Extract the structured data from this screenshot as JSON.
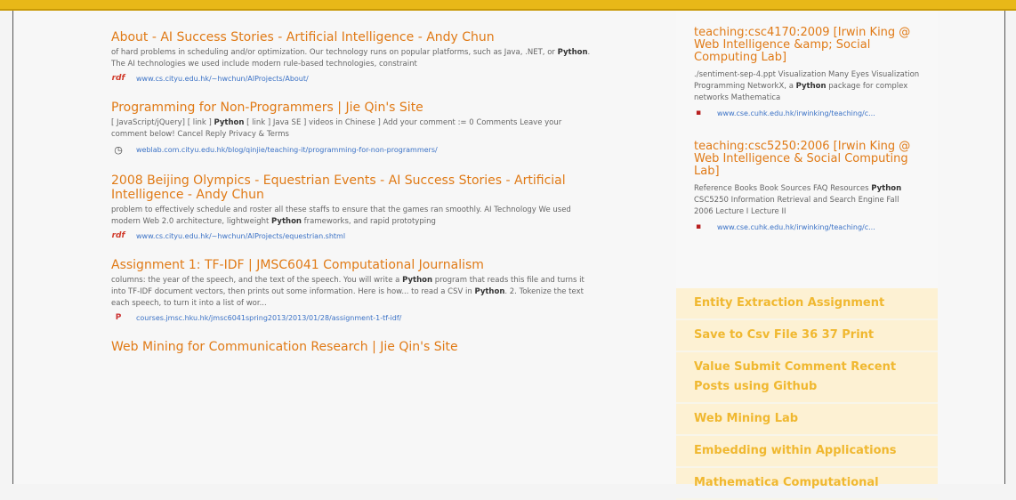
{
  "results": [
    {
      "title": "About - AI Success Stories - Artificial Intelligence - Andy Chun",
      "snippet_html": "of hard problems in scheduling and/or optimization. Our technology runs on popular platforms, such as Java, .NET, or <b>Python</b>. The AI technologies we used include modern rule-based technologies, constraint",
      "icon": "pdf-icon",
      "icon_glyph": "rdf",
      "url": "www.cs.cityu.edu.hk/~hwchun/AIProjects/About/"
    },
    {
      "title": "Programming for Non-Programmers | Jie Qin's Site",
      "snippet_html": "[ JavaScript/jQuery] [ link ] <b>Python</b> [ link ] Java SE ] videos in Chinese ] Add your comment := 0 Comments Leave your comment below! Cancel Reply Privacy &amp; Terms <iframe src=\"http://www.google.com/recaptcha/api",
      "icon": "clock-icon",
      "icon_glyph": "◷",
      "url": "weblab.com.cityu.edu.hk/blog/qinjie/teaching-it/programming-for-non-programmers/"
    },
    {
      "title": "2008 Beijing Olympics - Equestrian Events - AI Success Stories - Artificial Intelligence - Andy Chun",
      "snippet_html": "problem to effectively schedule and roster all these staffs to ensure that the games ran smoothly. AI Technology We used modern Web 2.0 architecture, lightweight <b>Python</b> frameworks, and rapid prototyping",
      "icon": "pdf-icon",
      "icon_glyph": "rdf",
      "url": "www.cs.cityu.edu.hk/~hwchun/AIProjects/equestrian.shtml"
    },
    {
      "title": "Assignment 1: TF-IDF | JMSC6041 Computational Journalism",
      "snippet_html": "columns: the year of the speech, and the text of the speech. You will write a <b>Python</b> program that reads this file and turns it into TF-IDF document vectors, then prints out some information. Here is how... to read a CSV in <b>Python</b>. 2. Tokenize the text each speech, to turn it into a list of wor...",
      "icon": "ppt-icon",
      "icon_glyph": "P",
      "url": "courses.jmsc.hku.hk/jmsc6041spring2013/2013/01/28/assignment-1-tf-idf/"
    },
    {
      "title": "Web Mining for Communication Research | Jie Qin's Site",
      "snippet_html": "",
      "icon": "",
      "icon_glyph": "",
      "url": ""
    }
  ],
  "sidebar": {
    "results": [
      {
        "title": "teaching:csc4170:2009 [Irwin King @ Web Intelligence &amp;amp; Social Computing Lab]",
        "snippet_html": "./sentiment-sep-4.ppt Visualization Many Eyes Visualization Programming NetworkX, a <b>Python</b> package for complex networks Mathematica",
        "icon": "bookmark-icon",
        "icon_glyph": "▪",
        "url": "www.cse.cuhk.edu.hk/irwinking/teaching/c..."
      },
      {
        "title": "teaching:csc5250:2006 [Irwin King @ Web Intelligence &amp; Social Computing Lab]",
        "snippet_html": "Reference Books Book Sources FAQ Resources <b>Python</b> CSC5250 Information Retrieval and Search Engine Fall 2006 Lecture I Lecture II",
        "icon": "bookmark-icon",
        "icon_glyph": "▪",
        "url": "www.cse.cuhk.edu.hk/irwinking/teaching/c..."
      }
    ],
    "related": [
      "Entity Extraction Assignment",
      "Save to Csv File 36 37 Print",
      "Value Submit Comment Recent Posts using Github",
      "Web Mining Lab",
      "Embedding within Applications",
      "Mathematica Computational"
    ]
  },
  "colors": {
    "topbar": "#e8b818",
    "title": "#e07a16",
    "url": "#3b72c6",
    "related_text": "#f0b830",
    "related_bg": "#fdf1d3"
  }
}
